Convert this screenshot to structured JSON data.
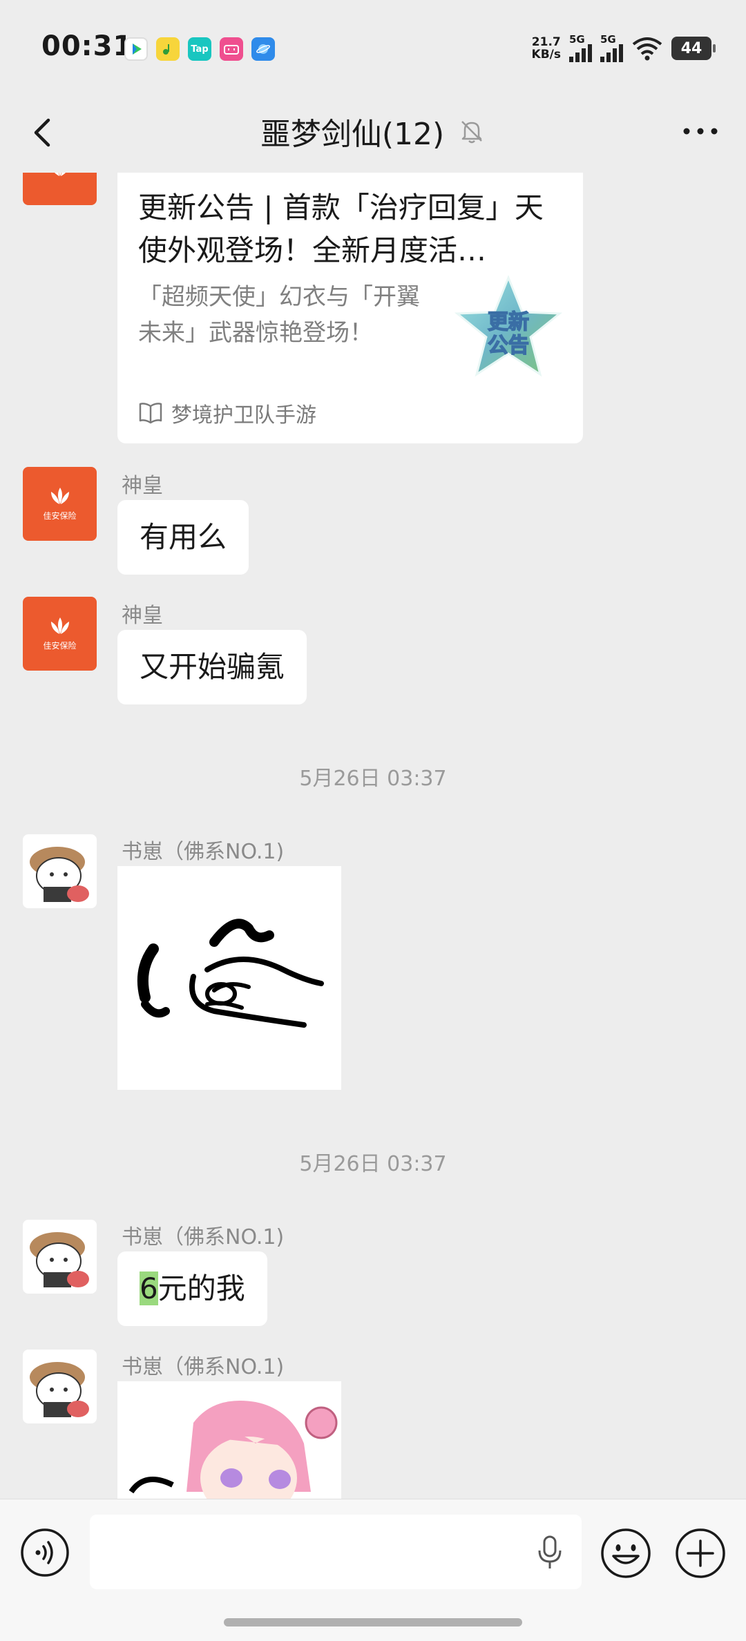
{
  "status_bar": {
    "time": "00:31",
    "net_speed_value": "21.7",
    "net_speed_unit": "KB/s",
    "signal1_label": "5G",
    "signal2_label": "5G",
    "battery": "44",
    "notification_icons": [
      "video-app-icon",
      "music-app-icon",
      "tap-app-icon",
      "bilibili-app-icon",
      "browser-app-icon"
    ],
    "tap_label": "Tap"
  },
  "header": {
    "title": "噩梦剑仙(12)"
  },
  "messages": {
    "card": {
      "title": "更新公告 | 首款「治疗回复」天使外观登场！全新月度活…",
      "desc": "「超频天使」幻衣与「开翼未来」武器惊艳登场！",
      "thumb_text_1": "更新",
      "thumb_text_2": "公告",
      "source": "梦境护卫队手游"
    },
    "avatar_red": {
      "brand": "佳安保险"
    },
    "msg1": {
      "sender": "神皇",
      "text": "有用么"
    },
    "msg2": {
      "sender": "神皇",
      "text": "又开始骗氪"
    },
    "timestamp1": "5月26日 03:37",
    "msg3": {
      "sender": "书崽（佛系NO.1)"
    },
    "timestamp2": "5月26日 03:37",
    "msg4": {
      "sender": "书崽（佛系NO.1)",
      "text_highlight": "6",
      "text_rest": "元的我"
    },
    "msg5": {
      "sender": "书崽（佛系NO.1)"
    }
  },
  "colors": {
    "avatar_red": "#ec5a2e",
    "highlight_green": "#9ad97e",
    "background": "#ededed"
  }
}
